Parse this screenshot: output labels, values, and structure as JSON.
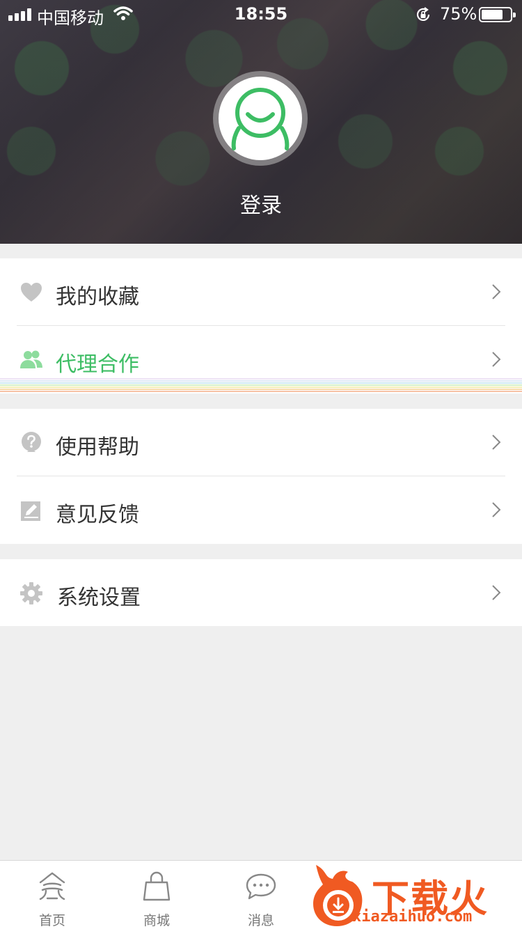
{
  "status_bar": {
    "carrier": "中国移动",
    "time": "18:55",
    "battery_percent": "75%",
    "battery_level": 0.75
  },
  "profile": {
    "login_label": "登录"
  },
  "menu": {
    "favorites": "我的收藏",
    "agent_cooperation": "代理合作",
    "help": "使用帮助",
    "feedback": "意见反馈",
    "settings": "系统设置"
  },
  "tabs": [
    {
      "label": "首页",
      "icon": "home-icon"
    },
    {
      "label": "商城",
      "icon": "shopping-bag-icon"
    },
    {
      "label": "消息",
      "icon": "message-icon"
    }
  ],
  "watermark": {
    "text": "下载火",
    "url": "xiazaihuo.com"
  },
  "colors": {
    "accent_green": "#3dbd64",
    "icon_gray": "#c4c4c4",
    "text_dark": "#333333",
    "watermark_orange": "#f05a22"
  }
}
